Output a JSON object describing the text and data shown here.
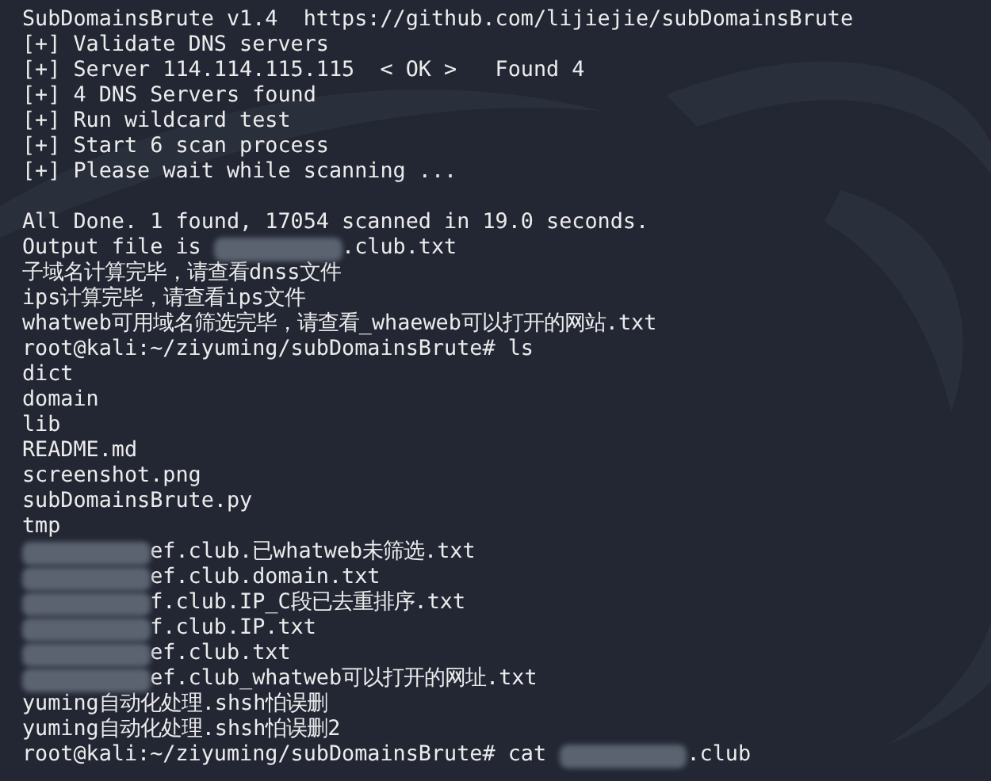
{
  "terminal": {
    "lines": [
      {
        "segments": [
          {
            "kind": "text",
            "text": "SubDomainsBrute v1.4  https://github.com/lijiejie/subDomainsBrute"
          }
        ]
      },
      {
        "segments": [
          {
            "kind": "text",
            "text": "[+] Validate DNS servers"
          }
        ]
      },
      {
        "segments": [
          {
            "kind": "text",
            "text": "[+] Server 114.114.115.115  < OK >   Found 4"
          }
        ]
      },
      {
        "segments": [
          {
            "kind": "text",
            "text": "[+] 4 DNS Servers found"
          }
        ]
      },
      {
        "segments": [
          {
            "kind": "text",
            "text": "[+] Run wildcard test"
          }
        ]
      },
      {
        "segments": [
          {
            "kind": "text",
            "text": "[+] Start 6 scan process"
          }
        ]
      },
      {
        "segments": [
          {
            "kind": "text",
            "text": "[+] Please wait while scanning ..."
          }
        ]
      },
      {
        "kind": "blank"
      },
      {
        "segments": [
          {
            "kind": "text",
            "text": "All Done. 1 found, 17054 scanned in 19.0 seconds."
          }
        ]
      },
      {
        "segments": [
          {
            "kind": "text",
            "text": "Output file is "
          },
          {
            "kind": "redacted"
          },
          {
            "kind": "text",
            "text": ".club.txt"
          }
        ]
      },
      {
        "segments": [
          {
            "kind": "text",
            "text": "子域名计算完毕，请查看dnss文件"
          }
        ]
      },
      {
        "segments": [
          {
            "kind": "text",
            "text": "ips计算完毕，请查看ips文件"
          }
        ]
      },
      {
        "segments": [
          {
            "kind": "text",
            "text": "whatweb可用域名筛选完毕，请查看_whaeweb可以打开的网站.txt"
          }
        ]
      },
      {
        "segments": [
          {
            "kind": "text",
            "text": "root@kali:~/ziyuming/subDomainsBrute# ls"
          }
        ]
      },
      {
        "segments": [
          {
            "kind": "text",
            "text": "dict"
          }
        ]
      },
      {
        "segments": [
          {
            "kind": "text",
            "text": "domain"
          }
        ]
      },
      {
        "segments": [
          {
            "kind": "text",
            "text": "lib"
          }
        ]
      },
      {
        "segments": [
          {
            "kind": "text",
            "text": "README.md"
          }
        ]
      },
      {
        "segments": [
          {
            "kind": "text",
            "text": "screenshot.png"
          }
        ]
      },
      {
        "segments": [
          {
            "kind": "text",
            "text": "subDomainsBrute.py"
          }
        ]
      },
      {
        "segments": [
          {
            "kind": "text",
            "text": "tmp"
          }
        ]
      },
      {
        "segments": [
          {
            "kind": "redacted"
          },
          {
            "kind": "text",
            "text": "ef.club.已whatweb未筛选.txt"
          }
        ]
      },
      {
        "segments": [
          {
            "kind": "redacted"
          },
          {
            "kind": "text",
            "text": "ef.club.domain.txt"
          }
        ]
      },
      {
        "segments": [
          {
            "kind": "redacted"
          },
          {
            "kind": "text",
            "text": "f.club.IP_C段已去重排序.txt"
          }
        ]
      },
      {
        "segments": [
          {
            "kind": "redacted"
          },
          {
            "kind": "text",
            "text": "f.club.IP.txt"
          }
        ]
      },
      {
        "segments": [
          {
            "kind": "redacted"
          },
          {
            "kind": "text",
            "text": "ef.club.txt"
          }
        ]
      },
      {
        "segments": [
          {
            "kind": "redacted"
          },
          {
            "kind": "text",
            "text": "ef.club_whatweb可以打开的网址.txt"
          }
        ]
      },
      {
        "segments": [
          {
            "kind": "text",
            "text": "yuming自动化处理.shsh怕误删"
          }
        ]
      },
      {
        "segments": [
          {
            "kind": "text",
            "text": "yuming自动化处理.shsh怕误删2"
          }
        ]
      },
      {
        "segments": [
          {
            "kind": "text",
            "text": "root@kali:~/ziyuming/subDomainsBrute# cat "
          },
          {
            "kind": "redacted"
          },
          {
            "kind": "text",
            "text": ".club"
          }
        ]
      }
    ]
  }
}
